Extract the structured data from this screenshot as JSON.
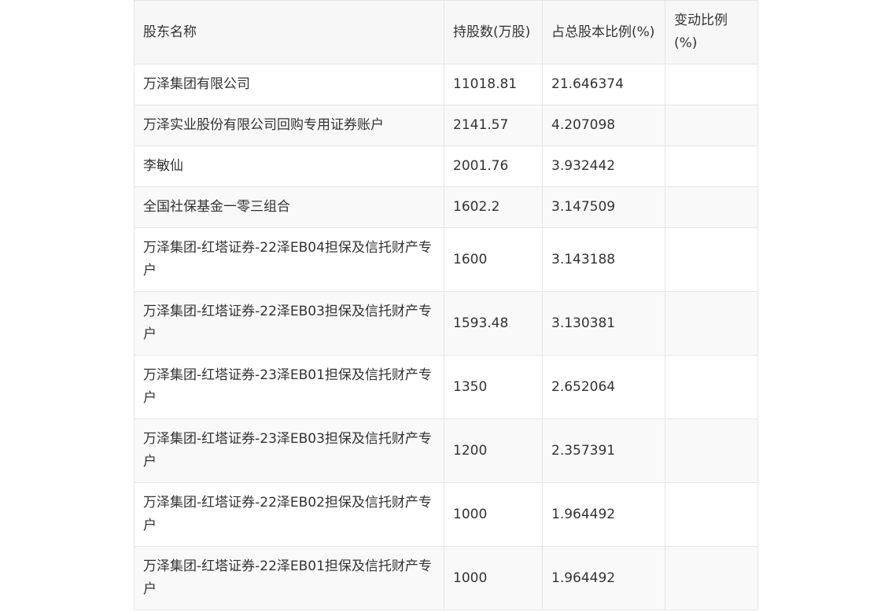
{
  "table": {
    "headers": [
      "股东名称",
      "持股数(万股)",
      "占总股本比例(%)",
      "变动比例(%)"
    ],
    "rows": [
      {
        "name": "万泽集团有限公司",
        "shares": "11018.81",
        "ratio": "21.646374",
        "change": ""
      },
      {
        "name": "万泽实业股份有限公司回购专用证券账户",
        "shares": "2141.57",
        "ratio": "4.207098",
        "change": ""
      },
      {
        "name": "李敏仙",
        "shares": "2001.76",
        "ratio": "3.932442",
        "change": ""
      },
      {
        "name": "全国社保基金一零三组合",
        "shares": "1602.2",
        "ratio": "3.147509",
        "change": ""
      },
      {
        "name": "万泽集团-红塔证券-22泽EB04担保及信托财产专户",
        "shares": "1600",
        "ratio": "3.143188",
        "change": ""
      },
      {
        "name": "万泽集团-红塔证券-22泽EB03担保及信托财产专户",
        "shares": "1593.48",
        "ratio": "3.130381",
        "change": ""
      },
      {
        "name": "万泽集团-红塔证券-23泽EB01担保及信托财产专户",
        "shares": "1350",
        "ratio": "2.652064",
        "change": ""
      },
      {
        "name": "万泽集团-红塔证券-23泽EB03担保及信托财产专户",
        "shares": "1200",
        "ratio": "2.357391",
        "change": ""
      },
      {
        "name": "万泽集团-红塔证券-22泽EB02担保及信托财产专户",
        "shares": "1000",
        "ratio": "1.964492",
        "change": ""
      },
      {
        "name": "万泽集团-红塔证券-22泽EB01担保及信托财产专户",
        "shares": "1000",
        "ratio": "1.964492",
        "change": ""
      }
    ]
  }
}
